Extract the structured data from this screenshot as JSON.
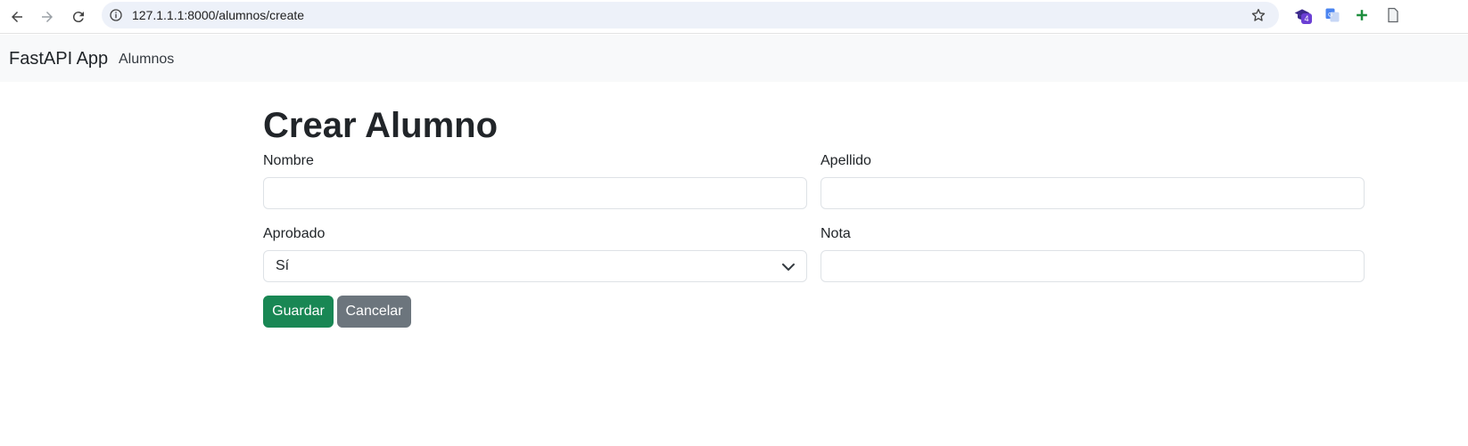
{
  "browser": {
    "url": "127.1.1.1:8000/alumnos/create",
    "extension_badge": "4"
  },
  "navbar": {
    "brand": "FastAPI App",
    "links": [
      "Alumnos"
    ]
  },
  "page": {
    "title": "Crear Alumno",
    "form": {
      "nombre_label": "Nombre",
      "apellido_label": "Apellido",
      "aprobado_label": "Aprobado",
      "aprobado_value": "Sí",
      "nota_label": "Nota",
      "save_label": "Guardar",
      "cancel_label": "Cancelar"
    }
  },
  "colors": {
    "primary_success": "#198754",
    "secondary": "#6c757d",
    "navbar_bg": "#f8f9fa",
    "omnibox_bg": "#edf1f9"
  }
}
